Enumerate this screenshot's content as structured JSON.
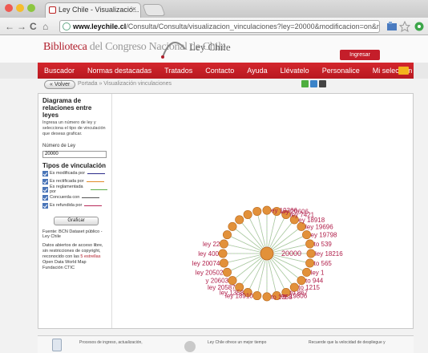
{
  "browser": {
    "tab_title": "Ley Chile - Visualizació...",
    "tab_close": "×",
    "url_host": "www.leychile.cl",
    "url_path": "/Consulta/Consulta/visualizacion_vinculaciones?ley=20000&modificacion=on&rectificacion=on&regula...",
    "back_glyph": "←",
    "forward_glyph": "→",
    "reload_glyph": "C",
    "home_glyph": "⌂",
    "icons": [
      "back-arrow-icon",
      "forward-arrow-icon",
      "reload-icon",
      "home-icon",
      "globe-icon",
      "extension-icon",
      "star-icon",
      "green-dot-icon"
    ]
  },
  "header": {
    "brand_main": "Biblioteca",
    "brand_rest": " del Congreso Nacional de Chile",
    "brand_secondary": "Ley Chile",
    "login_button": "Ingresar"
  },
  "menu": {
    "items": [
      "Buscador",
      "Normas destacadas",
      "Tratados",
      "Contacto",
      "Ayuda",
      "Llévatelo",
      "Personalice",
      "Mi selección"
    ]
  },
  "breadcrumb": {
    "back_button": "« Volver",
    "trail": "Portada » Visualización vinculaciones"
  },
  "sidebar": {
    "title": "Diagrama de relaciones entre leyes",
    "instructions": "Ingresa un número de ley y selecciona el tipo de vinculación que deseas graficar.",
    "number_label": "Número de Ley",
    "number_value": "20000",
    "types_title": "Tipos de vinculación",
    "types": [
      {
        "label": "Es modificada por",
        "color": "#2c2c8a"
      },
      {
        "label": "Es rectificada por",
        "color": "#e08a2a"
      },
      {
        "label": "Es reglamentada por",
        "color": "#5bb04a"
      },
      {
        "label": "Concuerda con",
        "color": "#555555"
      },
      {
        "label": "Es refundida por",
        "color": "#b82a5a"
      }
    ],
    "graph_button": "Graficar",
    "source": "Fuente: BCN Dataset público - Ley Chile",
    "license_a": "Datos abiertos de acceso libre, sin restricciones de copyright, reconocido con las ",
    "license_link": "5 estrellas",
    "license_b": " Open Data World Map Fundación CTIC"
  },
  "graph": {
    "center_label": "20000",
    "node_color": "#e2913a",
    "label_color": "#b01e4a",
    "nodes": [
      {
        "label": "ey 19366"
      },
      {
        "label": "ley 20606"
      },
      {
        "label": "ley 7421"
      },
      {
        "label": "ey 18918"
      },
      {
        "label": "ley 19696"
      },
      {
        "label": "ey 19798"
      },
      {
        "label": "to 539"
      },
      {
        "label": "ley 18216"
      },
      {
        "label": "to 565"
      },
      {
        "label": "ley 1"
      },
      {
        "label": "to 944"
      },
      {
        "label": "to 1215"
      },
      {
        "label": "to 867"
      },
      {
        "label": "ey 19806"
      },
      {
        "label": "to 1358"
      },
      {
        "label": "ley 18910"
      },
      {
        "label": "ley 1358"
      },
      {
        "label": "ley 20587"
      },
      {
        "label": "y 20603"
      },
      {
        "label": "ley 20502"
      },
      {
        "label": "ley 20074"
      },
      {
        "label": "ley 400"
      },
      {
        "label": "ley 22"
      },
      {
        "label": ""
      },
      {
        "label": ""
      },
      {
        "label": ""
      },
      {
        "label": ""
      },
      {
        "label": ""
      }
    ]
  },
  "footer": {
    "col1": "Procesos de ingreso, actualización,",
    "col2": "Ley Chile ofrece un mejor tiempo",
    "col3": "Recuerde que la velocidad de despliegue y"
  }
}
